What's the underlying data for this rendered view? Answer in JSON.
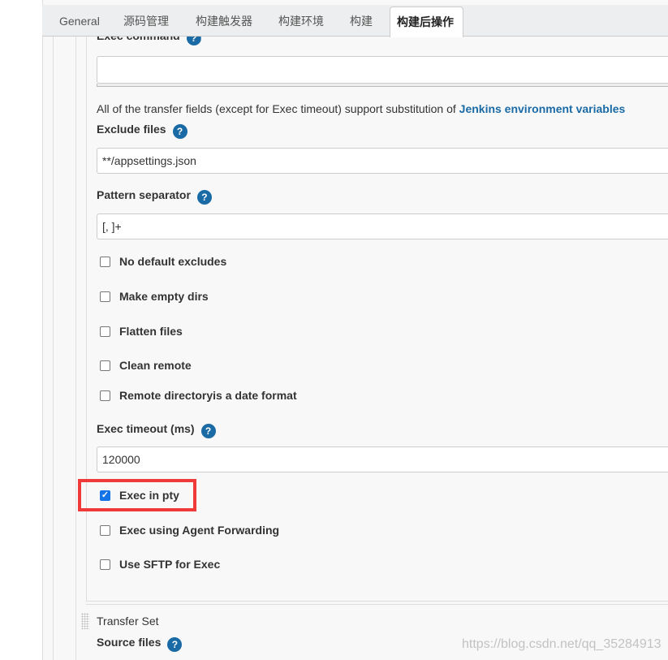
{
  "tabs": [
    "General",
    "源码管理",
    "构建触发器",
    "构建环境",
    "构建",
    "构建后操作"
  ],
  "active_tab": "构建后操作",
  "exec_command": {
    "label": "Exec command",
    "value": ""
  },
  "note": {
    "text": "All of the transfer fields (except for Exec timeout) support substitution of ",
    "link": "Jenkins environment variables"
  },
  "exclude_files": {
    "label": "Exclude files",
    "value": "**/appsettings.json"
  },
  "pattern_separator": {
    "label": "Pattern separator",
    "value": "[, ]+"
  },
  "checkboxes": [
    {
      "label": "No default excludes",
      "checked": false
    },
    {
      "label": "Make empty dirs",
      "checked": false
    },
    {
      "label": "Flatten files",
      "checked": false
    },
    {
      "label": "Clean remote",
      "checked": false
    },
    {
      "label": "Remote directoryis a date format",
      "checked": false
    }
  ],
  "exec_timeout": {
    "label": "Exec timeout (ms)",
    "value": "120000"
  },
  "checkboxes2": [
    {
      "label": "Exec in pty",
      "checked": true
    },
    {
      "label": "Exec using Agent Forwarding",
      "checked": false
    },
    {
      "label": "Use SFTP for Exec",
      "checked": false
    }
  ],
  "transfer_set": {
    "title": "Transfer Set",
    "source_label": "Source files"
  },
  "help_glyph": "?",
  "check_glyph": "✓",
  "watermark": "https://blog.csdn.net/qq_35284913",
  "colors": {
    "link": "#1a6aa6",
    "highlight": "#f03a3a",
    "checkbox": "#1473e6"
  }
}
